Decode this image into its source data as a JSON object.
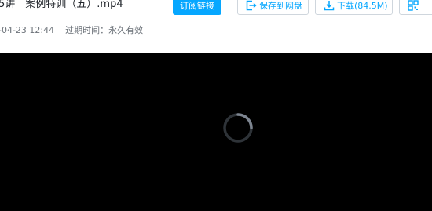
{
  "file": {
    "title": "5讲　案例特训（五）.mp4",
    "created_time": "-04-23 12:44",
    "expiry_label": "过期时间：永久有效"
  },
  "toolbar": {
    "subscribe_label": "订阅链接",
    "save_label": "保存到网盘",
    "download_label": "下载(84.5M)"
  },
  "icons": {
    "save": "save-to-drive-icon",
    "download": "download-icon",
    "more": "qr-code-icon"
  },
  "colors": {
    "accent": "#06a7ff",
    "player_background": "#000000",
    "meta_text": "#6b7178"
  },
  "player": {
    "state": "loading"
  }
}
